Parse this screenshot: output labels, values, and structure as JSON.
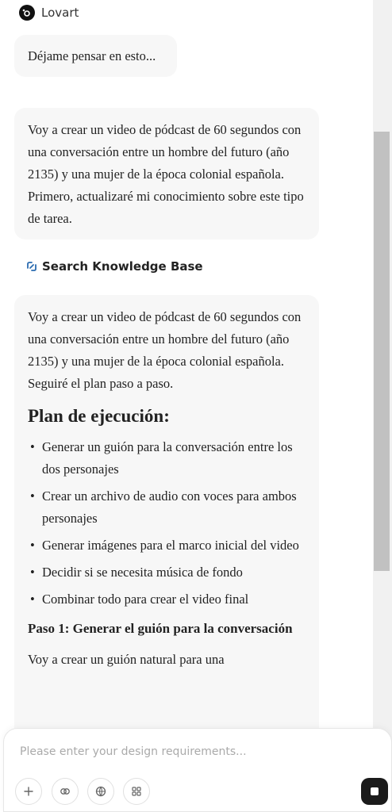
{
  "header": {
    "brand_name": "Lovart",
    "logo_icon": "lovart-logo-icon"
  },
  "messages": {
    "thinking": "Déjame pensar en esto...",
    "intro": "Voy a crear un video de pódcast de 60 segundos con una conversación entre un hombre del futuro (año 2135) y una mujer de la época colonial española. Primero, actualizaré mi conocimiento sobre este tipo de tarea.",
    "tool_call": {
      "label": "Search Knowledge Base",
      "icon": "link-icon",
      "color": "#2b6cb0"
    },
    "plan_intro": "Voy a crear un video de pódcast de 60 segundos con una conversación entre un hombre del futuro (año 2135) y una mujer de la época colonial española. Seguiré el plan paso a paso.",
    "plan_title": "Plan de ejecución:",
    "plan_steps": [
      "Generar un guión para la conversación entre los dos personajes",
      "Crear un archivo de audio con voces para ambos personajes",
      "Generar imágenes para el marco inicial del video",
      "Decidir si se necesita música de fondo",
      "Combinar todo para crear el video final"
    ],
    "step1_title": "Paso 1: Generar el guión para la conversación",
    "step1_text": "Voy a crear un guión natural para una"
  },
  "composer": {
    "placeholder": "Please enter your design requirements...",
    "buttons": [
      "plus-icon",
      "attach-icon",
      "globe-icon",
      "apps-grid-icon"
    ],
    "send_icon": "stop-icon"
  }
}
